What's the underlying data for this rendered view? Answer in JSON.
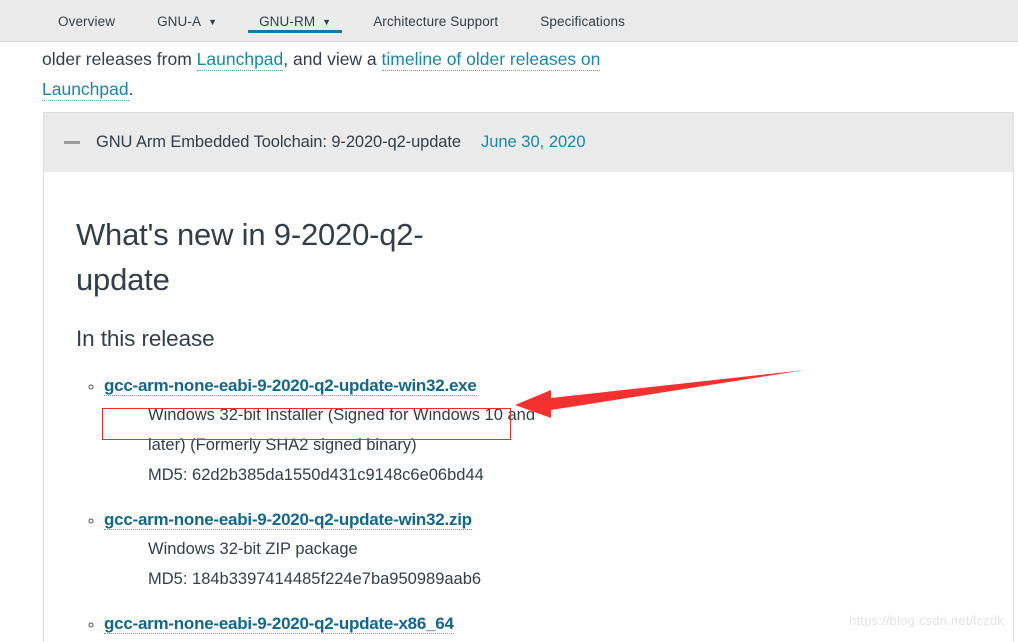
{
  "nav": {
    "items": [
      {
        "label": "Overview",
        "has_caret": false,
        "active": false
      },
      {
        "label": "GNU-A",
        "has_caret": true,
        "active": false
      },
      {
        "label": "GNU-RM",
        "has_caret": true,
        "active": true
      },
      {
        "label": "Architecture Support",
        "has_caret": false,
        "active": false
      },
      {
        "label": "Specifications",
        "has_caret": false,
        "active": false
      }
    ],
    "caret_glyph": "▼",
    "active_underline_color": "#0f7ca3"
  },
  "intro": {
    "text_1": "older releases from ",
    "link_1": "Launchpad",
    "text_2": ", and view a ",
    "link_2": "timeline of older releases on Launchpad",
    "text_3": "."
  },
  "accordion": {
    "collapse_icon": "minus-icon",
    "title": "GNU Arm Embedded Toolchain: 9-2020-q2-update",
    "date": "June 30, 2020"
  },
  "main": {
    "heading": "What's new in 9-2020-q2-update",
    "subheading": "In this release",
    "releases": [
      {
        "file": "gcc-arm-none-eabi-9-2020-q2-update-win32.exe",
        "description": "Windows 32-bit Installer (Signed for Windows 10 and later) (Formerly SHA2 signed binary)",
        "md5_label": "MD5:",
        "md5": "62d2b385da1550d431c9148c6e06bd44"
      },
      {
        "file": "gcc-arm-none-eabi-9-2020-q2-update-win32.zip",
        "description": "Windows 32-bit ZIP package",
        "md5_label": "MD5:",
        "md5": "184b3397414485f224e7ba950989aab6"
      },
      {
        "file": "gcc-arm-none-eabi-9-2020-q2-update-x86_64",
        "description": "",
        "md5_label": "",
        "md5": ""
      }
    ]
  },
  "annotations": {
    "highlight_color": "#ee2c2c",
    "arrow_color": "#f4312e",
    "arrow_direction": "left"
  },
  "watermark": {
    "text": "https://blog.csdn.net/lczdk"
  },
  "colors": {
    "link": "#1a87a8",
    "file_link": "#12678a",
    "header_bg": "#ebebeb",
    "text": "#333e48"
  }
}
